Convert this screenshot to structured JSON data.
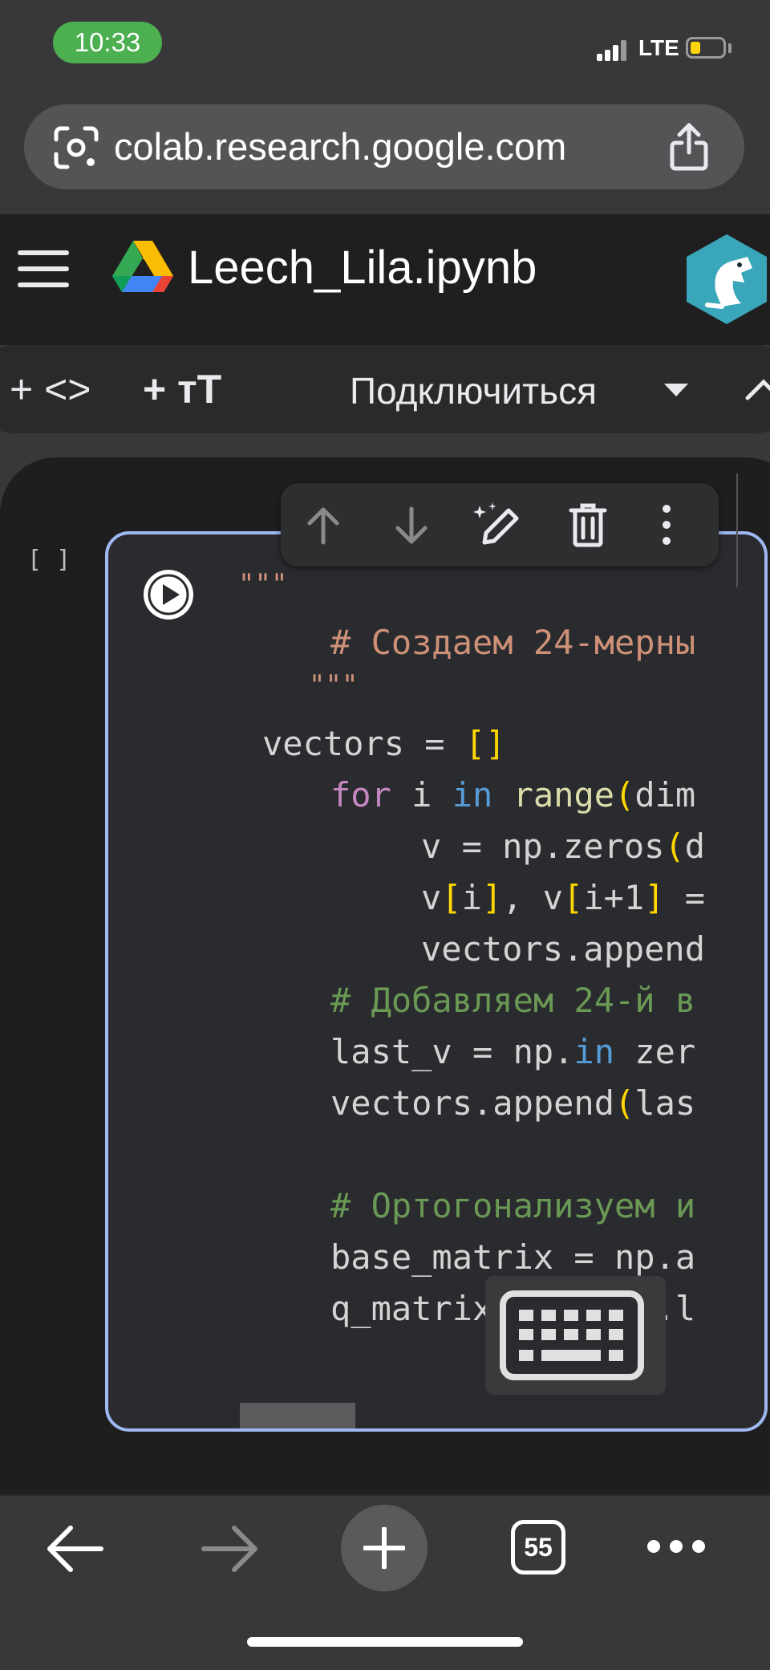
{
  "status_bar": {
    "time": "10:33",
    "network": "LTE",
    "battery_color": "#ffd60a"
  },
  "browser": {
    "url": "colab.research.google.com"
  },
  "notebook": {
    "title": "Leech_Lila.ipynb"
  },
  "toolbar": {
    "add_code": "+ <>",
    "add_text": "+ тT",
    "connect_label": "Подключиться"
  },
  "cell": {
    "execution_count": "[ ]",
    "code_lines": [
      "\"\"\"",
      "# Создаем 24-мерны",
      "\"\"\"",
      "vectors = []",
      "for i in range(dim",
      "v = np.zeros(d",
      "v[i], v[i+1] =",
      "vectors.append",
      "# Добавляем 24-й в",
      "last_v = np.in zer",
      "vectors.append(las",
      "",
      "# Ортогонализуем и",
      "base_matrix = np.a",
      "q_matrix, _ = np.l"
    ]
  },
  "bottom_bar": {
    "tab_count": "55"
  },
  "colors": {
    "accent_cell_border": "#9fb8f2",
    "status_pill": "#4caf50"
  }
}
